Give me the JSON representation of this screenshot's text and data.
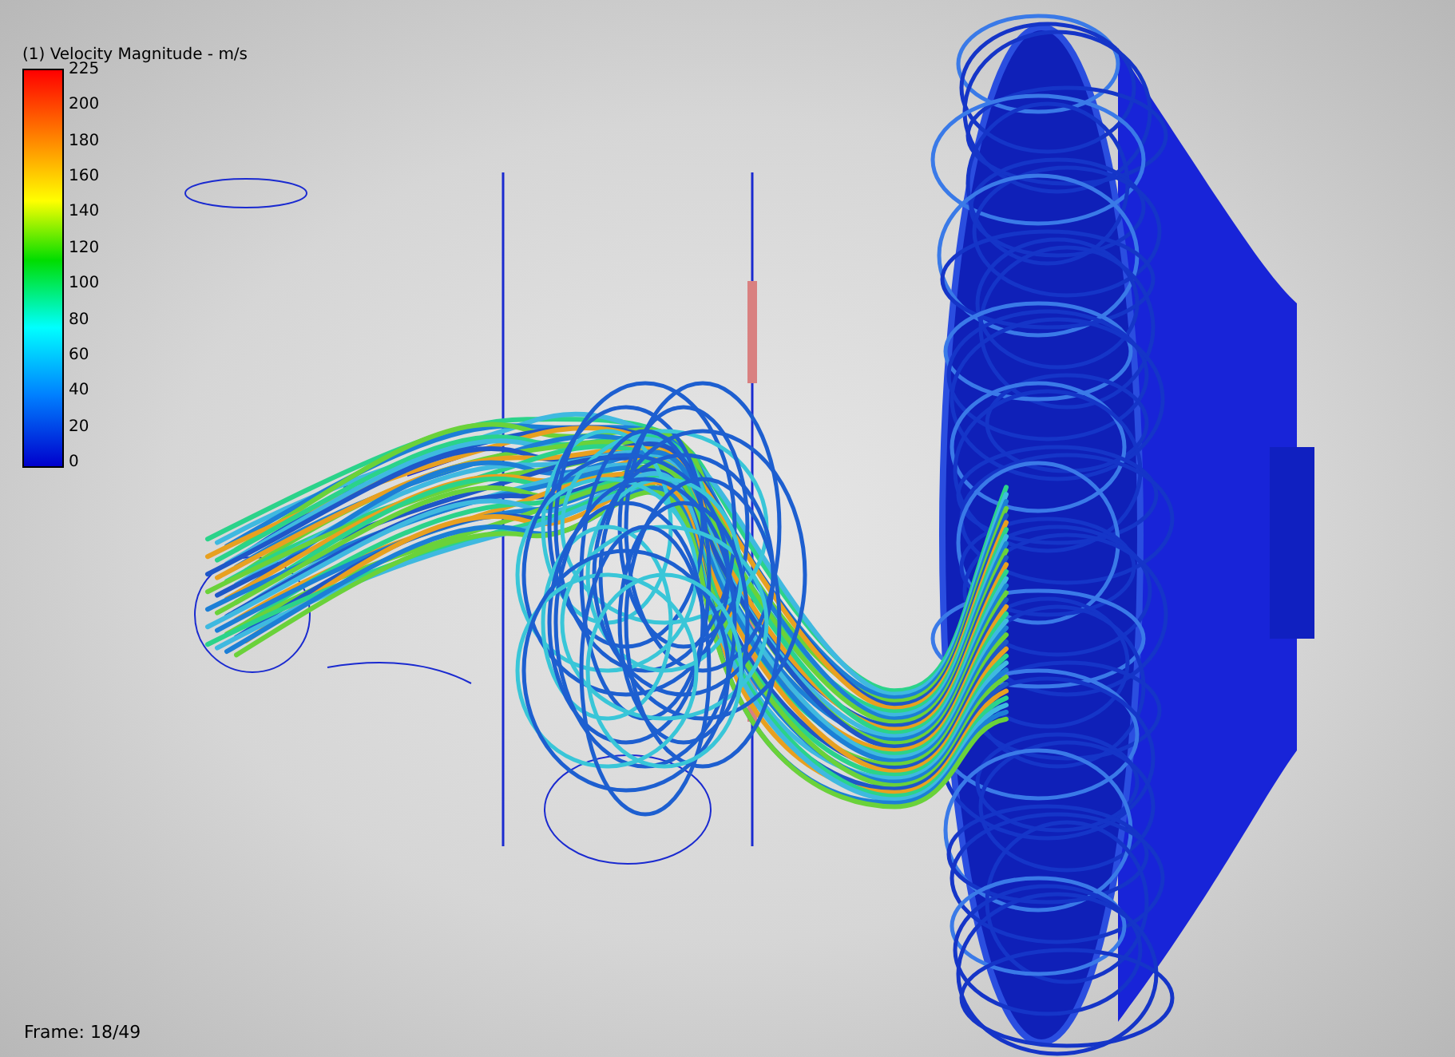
{
  "legend": {
    "title": "(1) Velocity Magnitude - m/s",
    "ticks": [
      "225",
      "200",
      "180",
      "160",
      "140",
      "120",
      "100",
      "80",
      "60",
      "40",
      "20",
      "0"
    ]
  },
  "frame": "Frame: 18/49"
}
